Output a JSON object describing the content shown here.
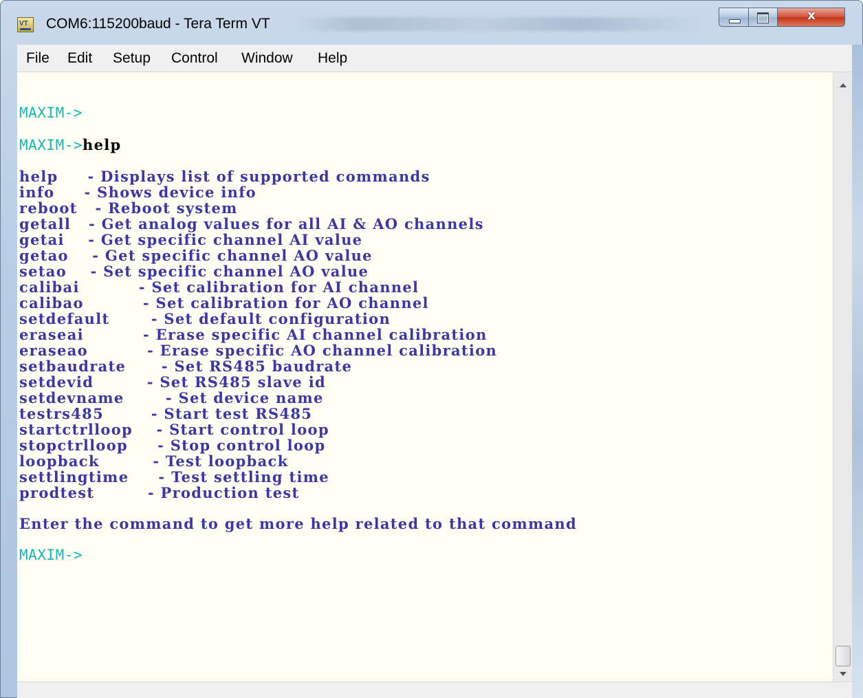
{
  "window": {
    "title": "COM6:115200baud - Tera Term VT",
    "icon": "tera-term-app-icon",
    "controls": {
      "minimize": "minimize-icon",
      "maximize": "maximize-icon",
      "close": "x"
    }
  },
  "menu": [
    {
      "label": "File"
    },
    {
      "label": "Edit"
    },
    {
      "label": "Setup"
    },
    {
      "label": "Control"
    },
    {
      "label": "Window"
    },
    {
      "label": "Help"
    }
  ],
  "terminal": {
    "colors": {
      "background": "#fffff4",
      "text": "#3c37a4",
      "prompt": "#13b8b8",
      "input": "#000000"
    },
    "prompt": "MAXIM->",
    "entered_command": "help",
    "help_lines": [
      "help     - Displays list of supported commands",
      "info     - Shows device info",
      "reboot   - Reboot system",
      "getall   - Get analog values for all AI & AO channels",
      "getai    - Get specific channel AI value",
      "getao    - Get specific channel AO value",
      "setao    - Set specific channel AO value",
      "calibai          - Set calibration for AI channel",
      "calibao          - Set calibration for AO channel",
      "setdefault       - Set default configuration",
      "eraseai          - Erase specific AI channel calibration",
      "eraseao          - Erase specific AO channel calibration",
      "setbaudrate      - Set RS485 baudrate",
      "setdevid         - Set RS485 slave id",
      "setdevname       - Set device name",
      "testrs485        - Start test RS485",
      "startctrlloop    - Start control loop",
      "stopctrlloop     - Stop control loop",
      "loopback         - Test loopback",
      "settlingtime     - Test settling time",
      "prodtest         - Production test"
    ],
    "footer": "Enter the command to get more help related to that command"
  }
}
